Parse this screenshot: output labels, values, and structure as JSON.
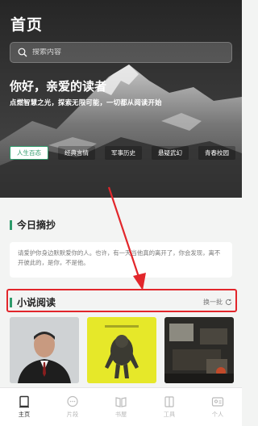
{
  "header": {
    "title": "首页",
    "search_placeholder": "搜索内容"
  },
  "hero": {
    "greeting": "你好，亲爱的读者",
    "slogan": "点燃智慧之光，探索无限可能，一切都从阅读开始"
  },
  "tabs": [
    {
      "label": "人生百态",
      "active": true
    },
    {
      "label": "经典言情",
      "active": false
    },
    {
      "label": "军事历史",
      "active": false
    },
    {
      "label": "悬疑武幻",
      "active": false
    },
    {
      "label": "青春校园",
      "active": false
    }
  ],
  "excerpt": {
    "title": "今日摘抄",
    "text": "请爱护你身边默默爱你的人。也许，有一天当他真的离开了，你会发现，离不开彼此的，是你，不是他。"
  },
  "novels": {
    "title": "小说阅读",
    "refresh_label": "换一批",
    "covers": [
      {
        "icon": "portrait-cover"
      },
      {
        "icon": "ape-illustration-cover"
      },
      {
        "icon": "room-photo-cover"
      }
    ]
  },
  "bottom_nav": [
    {
      "label": "主页",
      "icon": "home-icon",
      "active": true
    },
    {
      "label": "片段",
      "icon": "chat-bubble-icon",
      "active": false
    },
    {
      "label": "书屋",
      "icon": "books-icon",
      "active": false
    },
    {
      "label": "工具",
      "icon": "tools-icon",
      "active": false
    },
    {
      "label": "个人",
      "icon": "profile-icon",
      "active": false
    }
  ],
  "colors": {
    "accent": "#2e9b6b",
    "annotation": "#e2262b"
  }
}
